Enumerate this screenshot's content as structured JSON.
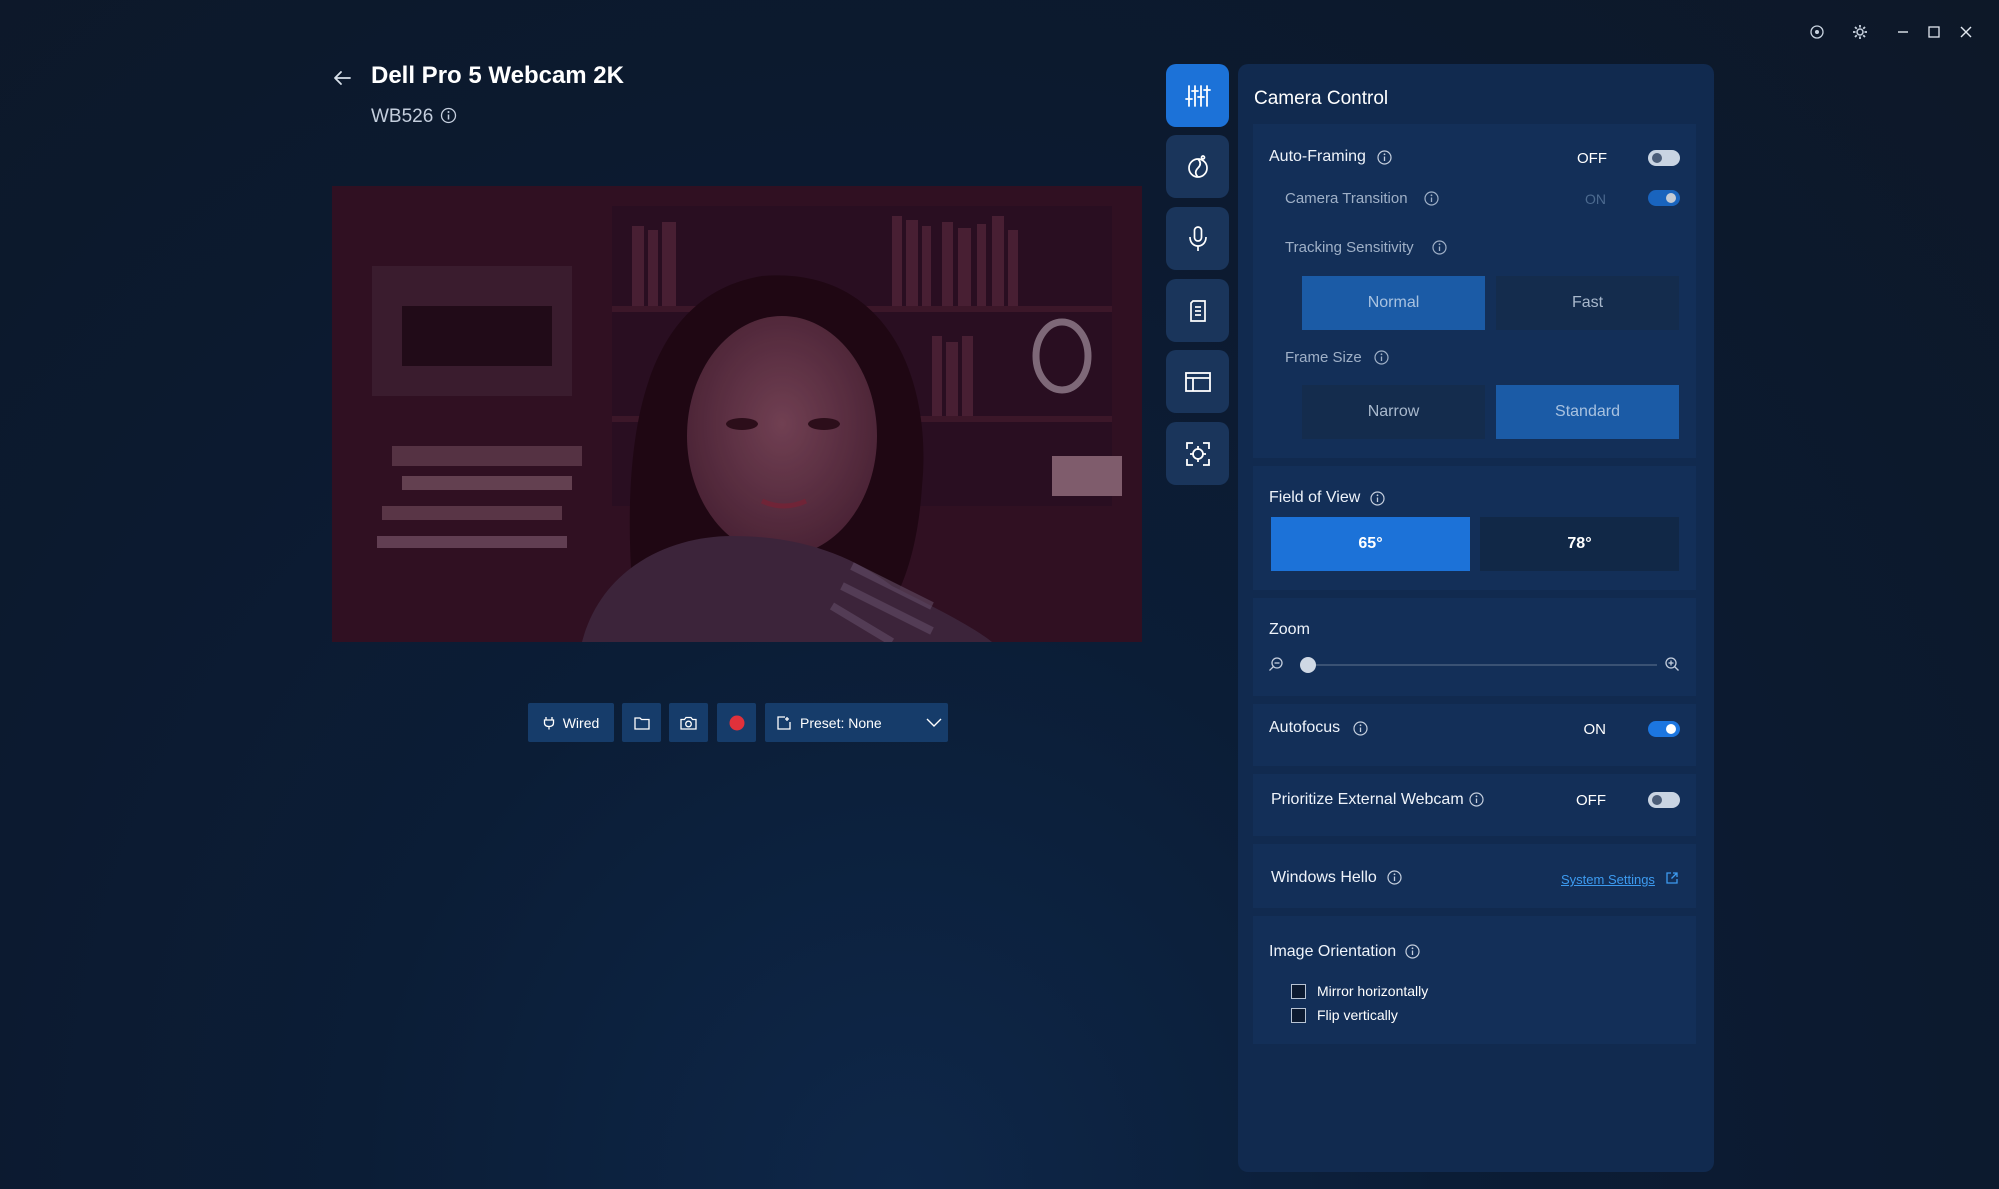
{
  "header": {
    "device_name": "Dell Pro 5 Webcam 2K",
    "model": "WB526"
  },
  "toolbar": {
    "connection_label": "Wired",
    "preset_label": "Preset: None"
  },
  "panel": {
    "title": "Camera Control",
    "auto_framing": {
      "label": "Auto-Framing",
      "state": "OFF",
      "camera_transition": {
        "label": "Camera Transition",
        "state": "ON"
      },
      "tracking_sensitivity": {
        "label": "Tracking Sensitivity",
        "options": [
          "Normal",
          "Fast"
        ],
        "selected": "Normal"
      },
      "frame_size": {
        "label": "Frame Size",
        "options": [
          "Narrow",
          "Standard"
        ],
        "selected": "Standard"
      }
    },
    "field_of_view": {
      "label": "Field of View",
      "options": [
        "65°",
        "78°"
      ],
      "selected": "65°"
    },
    "zoom": {
      "label": "Zoom",
      "value": 0.0
    },
    "autofocus": {
      "label": "Autofocus",
      "state": "ON"
    },
    "prioritize_external": {
      "label": "Prioritize External Webcam",
      "state": "OFF"
    },
    "windows_hello": {
      "label": "Windows Hello",
      "link": "System Settings"
    },
    "image_orientation": {
      "label": "Image Orientation",
      "options": [
        {
          "label": "Mirror horizontally",
          "checked": false
        },
        {
          "label": "Flip vertically",
          "checked": false
        }
      ]
    }
  },
  "colors": {
    "accent": "#1c72d8",
    "panel_bg": "#112a4f",
    "card_bg": "#132f58",
    "record_red": "#e0313b"
  },
  "icons": {
    "titlebar": [
      "target-icon",
      "gear-icon",
      "minimize-icon",
      "maximize-icon",
      "close-icon"
    ],
    "sidebar": [
      "sliders-icon",
      "color-palette-icon",
      "microphone-icon",
      "document-icon",
      "layout-icon",
      "focus-target-icon"
    ]
  }
}
